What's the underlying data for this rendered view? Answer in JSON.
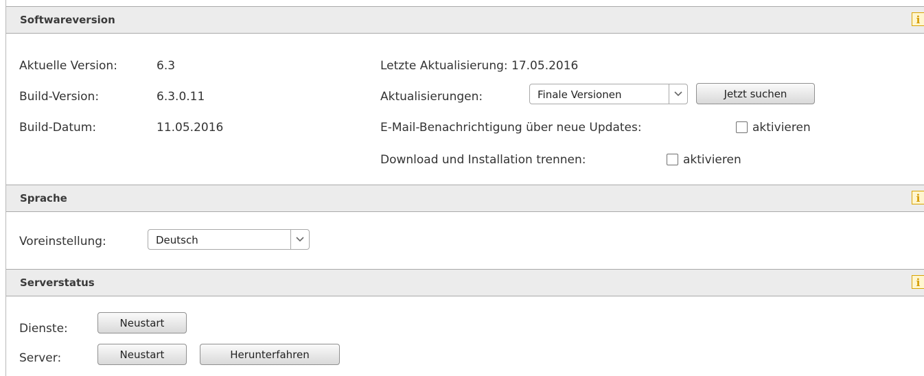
{
  "software": {
    "header": "Softwareversion",
    "current_label": "Aktuelle Version:",
    "current_value": "6.3",
    "build_label": "Build-Version:",
    "build_value": "6.3.0.11",
    "date_label": "Build-Datum:",
    "date_value": "11.05.2016",
    "last_update": "Letzte Aktualisierung: 17.05.2016",
    "updates_label": "Aktualisierungen:",
    "updates_selected": "Finale Versionen",
    "search_button": "Jetzt suchen",
    "email_label": "E-Mail-Benachrichtigung über neue Updates:",
    "email_checkbox_label": "aktivieren",
    "email_checked": false,
    "download_label": "Download und Installation trennen:",
    "download_checkbox_label": "aktivieren",
    "download_checked": false
  },
  "language": {
    "header": "Sprache",
    "default_label": "Voreinstellung:",
    "default_selected": "Deutsch"
  },
  "server": {
    "header": "Serverstatus",
    "services_label": "Dienste:",
    "services_restart": "Neustart",
    "server_label": "Server:",
    "server_restart": "Neustart",
    "server_shutdown": "Herunterfahren"
  },
  "icons": {
    "info": "info-icon",
    "dropdown": "chevron-down-icon"
  },
  "colors": {
    "header_bg": "#ececec",
    "info_accent": "#d49a00"
  }
}
